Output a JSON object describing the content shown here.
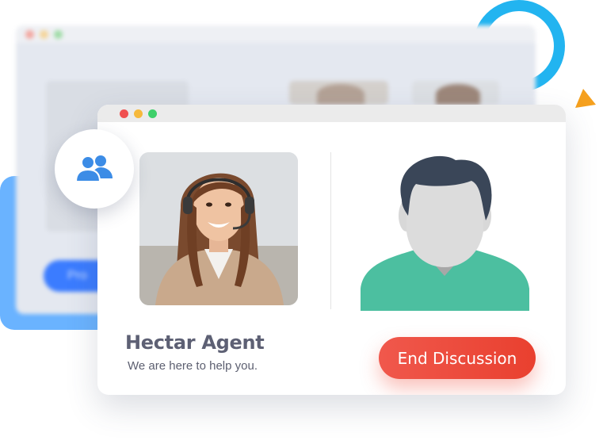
{
  "colors": {
    "accent_blue": "#22b4f0",
    "accent_orange": "#f5a01e",
    "button_red": "#ef5046",
    "icon_blue": "#3c8ce6",
    "avatar_body": "#4cbfa0",
    "avatar_hair": "#3a4658",
    "text_dark": "#5d6074"
  },
  "agent": {
    "name": "Hectar Agent",
    "tagline": "We are here to help you."
  },
  "actions": {
    "end_label": "End Discussion"
  },
  "icons": {
    "group": "users-group-icon",
    "user": "user-avatar-icon"
  }
}
